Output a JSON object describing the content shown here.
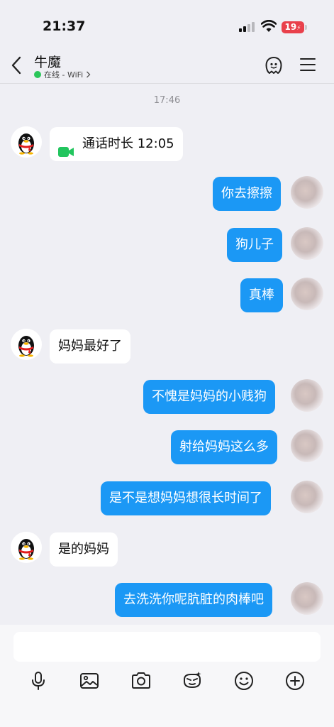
{
  "status_bar": {
    "time": "21:37",
    "battery": "19",
    "battery_color": "#e9404b"
  },
  "header": {
    "contact_name": "牛魔",
    "online_status": "在线 - WiFi",
    "back_icon": "chevron-left-icon",
    "ghost_icon": "ghost-icon",
    "menu_icon": "menu-icon"
  },
  "chat": {
    "timestamp": "17:46",
    "messages": [
      {
        "side": "in",
        "type": "call",
        "text": "通话时长 12:05"
      },
      {
        "side": "out",
        "text": "你去擦擦"
      },
      {
        "side": "out",
        "text": "狗儿子"
      },
      {
        "side": "out",
        "text": "真棒"
      },
      {
        "side": "in",
        "text": "妈妈最好了"
      },
      {
        "side": "out",
        "text": "不愧是妈妈的小贱狗"
      },
      {
        "side": "out",
        "text": "射给妈妈这么多"
      },
      {
        "side": "out",
        "text": "是不是想妈妈想很长时间了"
      },
      {
        "side": "in",
        "text": "是的妈妈"
      },
      {
        "side": "out",
        "text": "去洗洗你呢肮脏的肉棒吧"
      }
    ]
  },
  "input": {
    "value": ""
  },
  "toolbar": {
    "icons": [
      "microphone-icon",
      "image-icon",
      "camera-icon",
      "sticker-icon",
      "emoji-icon",
      "plus-icon"
    ]
  },
  "colors": {
    "outgoing_bubble": "#1b98f5",
    "incoming_bubble": "#ffffff",
    "background": "#efeff4",
    "online": "#2bc65a",
    "call": "#22c55e"
  }
}
